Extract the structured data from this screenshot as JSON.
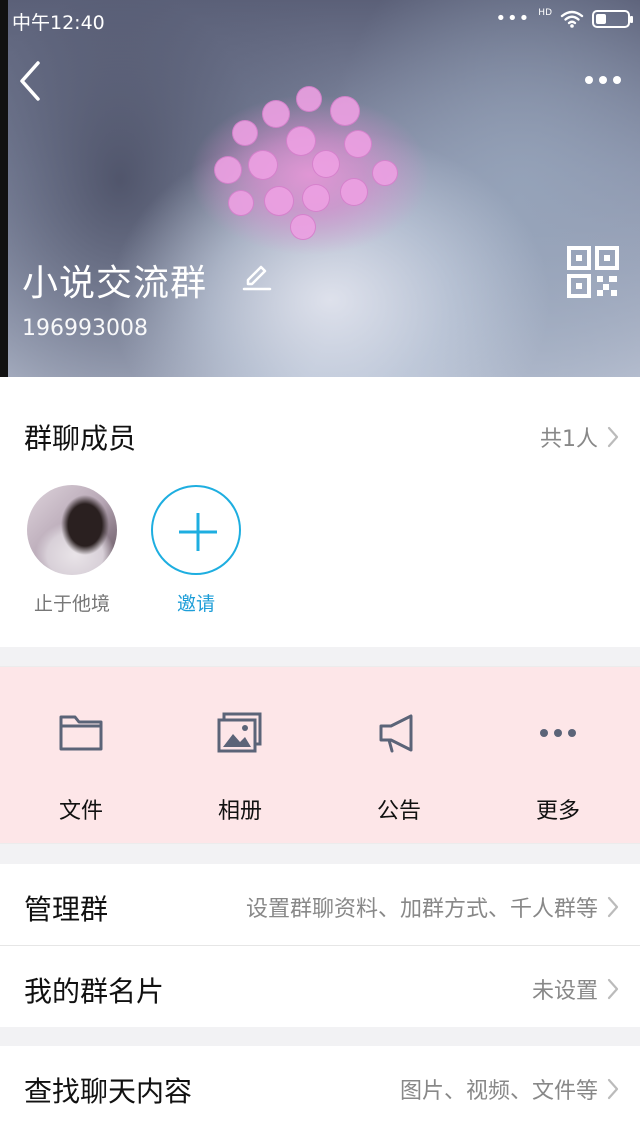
{
  "status_bar": {
    "time": "中午12:40",
    "network_label": "HD"
  },
  "header": {
    "group_name": "小说交流群",
    "group_id": "196993008"
  },
  "members": {
    "title": "群聊成员",
    "count_label": "共1人",
    "items": [
      {
        "name": "止于他境"
      }
    ],
    "invite_label": "邀请"
  },
  "actions": [
    {
      "label": "文件",
      "icon": "folder-icon"
    },
    {
      "label": "相册",
      "icon": "photo-album-icon"
    },
    {
      "label": "公告",
      "icon": "megaphone-icon"
    },
    {
      "label": "更多",
      "icon": "more-horizontal-icon"
    }
  ],
  "settings": {
    "manage_group": {
      "label": "管理群",
      "value": "设置群聊资料、加群方式、千人群等"
    },
    "my_card": {
      "label": "我的群名片",
      "value": "未设置"
    },
    "search_history": {
      "label": "查找聊天内容",
      "value": "图片、视频、文件等"
    }
  },
  "colors": {
    "accent": "#1eaee0",
    "actions_bg": "#fde6e8"
  }
}
